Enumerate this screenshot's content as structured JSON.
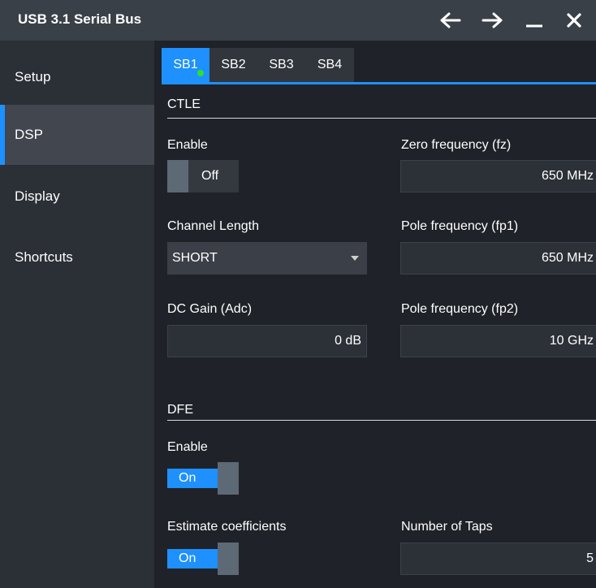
{
  "window": {
    "title": "USB 3.1 Serial Bus",
    "controls": [
      "arrow-left-icon",
      "arrow-right-icon",
      "minimize-icon",
      "close-icon"
    ]
  },
  "sidebar": {
    "items": [
      {
        "label": "Setup"
      },
      {
        "label": "DSP"
      },
      {
        "label": "Display"
      },
      {
        "label": "Shortcuts"
      }
    ],
    "active_index": 1
  },
  "tabs": {
    "items": [
      "SB1",
      "SB2",
      "SB3",
      "SB4"
    ],
    "active_index": 0
  },
  "ctle": {
    "section_title": "CTLE",
    "enable": {
      "label": "Enable",
      "state": "Off"
    },
    "zero_freq": {
      "label": "Zero frequency (fz)",
      "value": "650 MHz"
    },
    "channel_length": {
      "label": "Channel Length",
      "value": "SHORT"
    },
    "pole_freq1": {
      "label": "Pole frequency (fp1)",
      "value": "650 MHz"
    },
    "dc_gain": {
      "label": "DC Gain (Adc)",
      "value": "0 dB"
    },
    "pole_freq2": {
      "label": "Pole frequency (fp2)",
      "value": "10 GHz"
    }
  },
  "dfe": {
    "section_title": "DFE",
    "enable": {
      "label": "Enable",
      "state": "On"
    },
    "estimate": {
      "label": "Estimate coefficients",
      "state": "On"
    },
    "taps": {
      "label": "Number of Taps",
      "value": "5"
    }
  },
  "colors": {
    "accent": "#1e90ff",
    "status_dot": "#2ee02e",
    "background": "#1f2228",
    "sidebar": "#2b2f36",
    "titlebar": "#3a4048"
  }
}
